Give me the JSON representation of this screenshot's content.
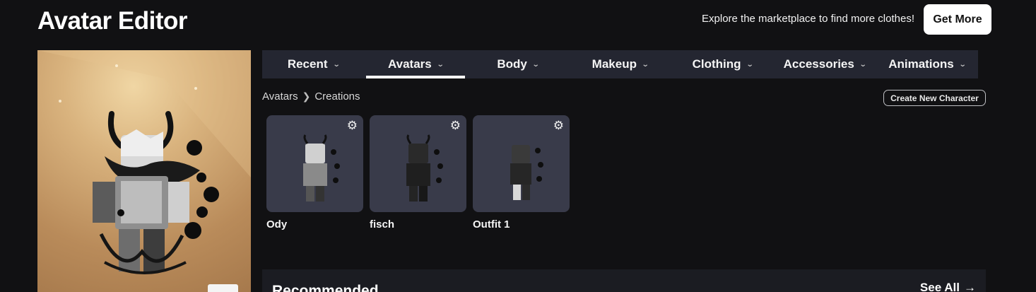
{
  "header": {
    "title": "Avatar Editor",
    "promo_text": "Explore the marketplace to find more clothes!",
    "get_more_label": "Get More"
  },
  "tabs": [
    {
      "label": "Recent",
      "active": false
    },
    {
      "label": "Avatars",
      "active": true
    },
    {
      "label": "Body",
      "active": false
    },
    {
      "label": "Makeup",
      "active": false
    },
    {
      "label": "Clothing",
      "active": false
    },
    {
      "label": "Accessories",
      "active": false
    },
    {
      "label": "Animations",
      "active": false
    }
  ],
  "breadcrumb": {
    "root": "Avatars",
    "current": "Creations"
  },
  "create_button_label": "Create New Character",
  "creations": [
    {
      "name": "Ody"
    },
    {
      "name": "fisch"
    },
    {
      "name": "Outfit 1"
    }
  ],
  "recommended": {
    "title": "Recommended",
    "see_all_label": "See All"
  },
  "icons": {
    "chevron": "chevron-down-icon",
    "gear": "gear-icon",
    "breadcrumb_separator": "chevron-right-icon",
    "see_all_arrow": "arrow-right-icon"
  },
  "colors": {
    "background": "#111113",
    "tabbar": "#242631",
    "card": "#393b4a",
    "preview_gold": "#d9b37e"
  }
}
